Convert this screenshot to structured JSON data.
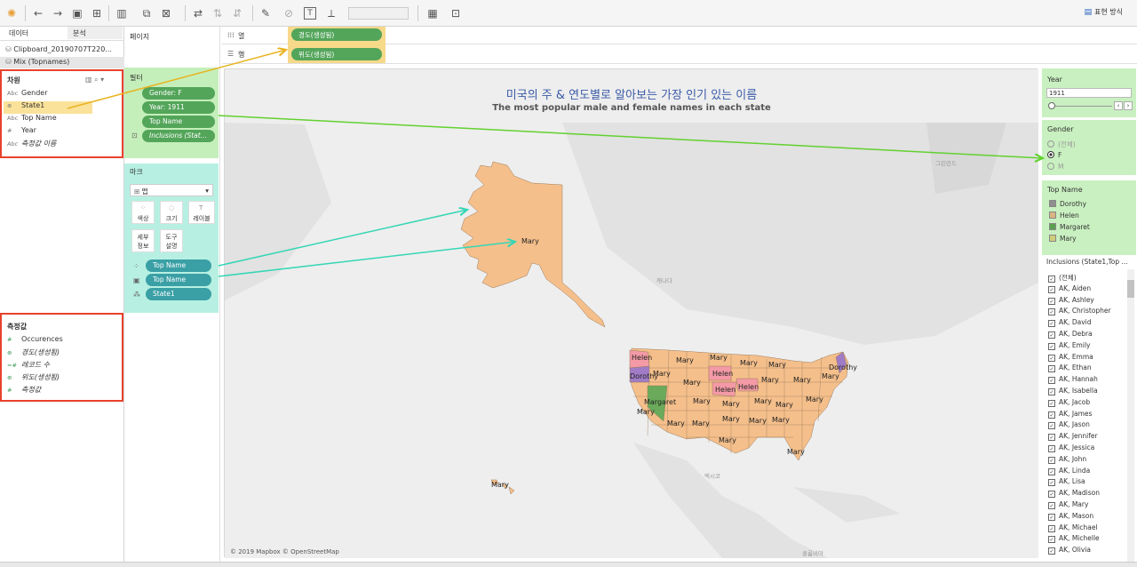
{
  "toolbar": {
    "present_label": "표현 방식"
  },
  "left": {
    "tabs": [
      "데이터",
      "분석"
    ],
    "sources": [
      "Clipboard_20190707T220...",
      "Mix (Topnames)"
    ],
    "dims_title": "차원",
    "dimensions": [
      {
        "type": "Abc",
        "name": "Gender"
      },
      {
        "type": "geo",
        "name": "State1"
      },
      {
        "type": "Abc",
        "name": "Top Name"
      },
      {
        "type": "#",
        "name": "Year"
      },
      {
        "type": "Abc",
        "name": "측정값 이름"
      }
    ],
    "measures_title": "측정값",
    "measures": [
      {
        "type": "#",
        "name": "Occurences"
      },
      {
        "type": "geo",
        "name": "경도(생성됨)"
      },
      {
        "type": "=#",
        "name": "레코드 수"
      },
      {
        "type": "geo",
        "name": "위도(생성됨)"
      },
      {
        "type": "#",
        "name": "측정값"
      }
    ]
  },
  "pages_label": "페이지",
  "filters": {
    "title": "필터",
    "items": [
      "Gender: F",
      "Year: 1911",
      "Top Name",
      "Inclusions (Stat..."
    ]
  },
  "marks": {
    "title": "마크",
    "type": "맵",
    "buttons": [
      "색상",
      "크기",
      "레이블",
      "세부\n정보",
      "도구\n설명"
    ],
    "pills": [
      "Top Name",
      "Top Name",
      "State1"
    ]
  },
  "columns": {
    "label": "열",
    "pill": "경도(생성됨)"
  },
  "rows": {
    "label": "행",
    "pill": "위도(생성됨)"
  },
  "view": {
    "title": "미국의 주 & 연도별로 알아보는 가장 인기 있는 이름",
    "subtitle": "The most popular male and female names in each state",
    "attribution": "© 2019 Mapbox © OpenStreetMap",
    "labels": [
      "Mary",
      "Helen",
      "Dorothy",
      "Margaret",
      "Helen",
      "Helen",
      "Helen",
      "Mary",
      "Dorothy",
      "Mary"
    ],
    "colors": {
      "Mary": "#f5bf8b",
      "Helen": "#f49aa6",
      "Dorothy": "#a07cc6",
      "Margaret": "#6aaa5a",
      "land": "#e2e2e2",
      "water": "#eeeeee"
    }
  },
  "right": {
    "year_title": "Year",
    "year_value": "1911",
    "gender_title": "Gender",
    "gender_options": [
      "(전체)",
      "F",
      "M"
    ],
    "gender_selected": "F",
    "top_name_title": "Top Name",
    "top_names": [
      {
        "name": "Dorothy",
        "color": "#8f8f8f"
      },
      {
        "name": "Helen",
        "color": "#d9b483"
      },
      {
        "name": "Margaret",
        "color": "#5aa04f"
      },
      {
        "name": "Mary",
        "color": "#cfcf7a"
      }
    ],
    "inclusions_title": "Inclusions (State1,Top ...",
    "inclusions": [
      "(전체)",
      "AK, Aiden",
      "AK, Ashley",
      "AK, Christopher",
      "AK, David",
      "AK, Debra",
      "AK, Emily",
      "AK, Emma",
      "AK, Ethan",
      "AK, Hannah",
      "AK, Isabella",
      "AK, Jacob",
      "AK, James",
      "AK, Jason",
      "AK, Jennifer",
      "AK, Jessica",
      "AK, John",
      "AK, Linda",
      "AK, Lisa",
      "AK, Madison",
      "AK, Mary",
      "AK, Mason",
      "AK, Michael",
      "AK, Michelle",
      "AK, Olivia"
    ]
  }
}
